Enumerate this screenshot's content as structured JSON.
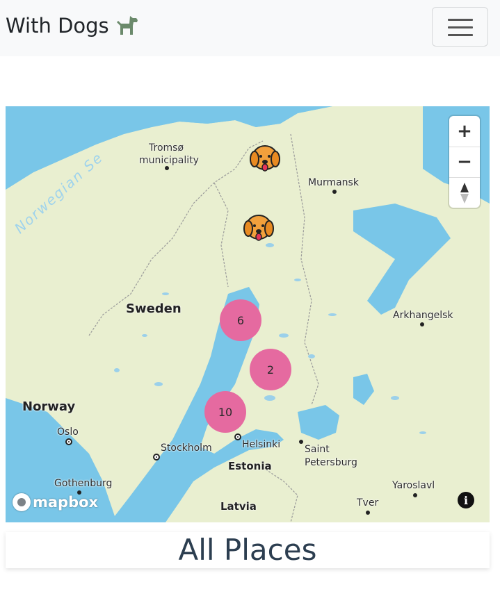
{
  "navbar": {
    "brand": "With Dogs",
    "brand_icon": "dog-icon",
    "toggler_icon": "hamburger-menu-icon"
  },
  "map": {
    "labels": {
      "sea": "Norwegian Se",
      "tromso": "Tromsø",
      "tromso2": "municipality",
      "murmansk": "Murmansk",
      "sweden": "Sweden",
      "norway": "Norway",
      "arkhangelsk": "Arkhangelsk",
      "oslo": "Oslo",
      "stockholm": "Stockholm",
      "helsinki": "Helsinki",
      "saint": "Saint",
      "petersburg": "Petersburg",
      "estonia": "Estonia",
      "gothenburg": "Gothenburg",
      "latvia": "Latvia",
      "tver": "Tver",
      "yaroslavl": "Yaroslavl"
    },
    "clusters": [
      {
        "count": "6"
      },
      {
        "count": "2"
      },
      {
        "count": "10"
      }
    ],
    "controls": {
      "zoom_in": "+",
      "zoom_out": "−",
      "compass": "compass-icon"
    },
    "attribution_logo": "mapbox",
    "info_icon": "i"
  },
  "section": {
    "title": "All Places"
  },
  "colors": {
    "water": "#79c6e8",
    "land": "#e9efd0",
    "cluster": "#e56aa0",
    "dog_marker": "#f2a03c",
    "title": "#2c3e50",
    "navbar": "#f8f9fa"
  }
}
